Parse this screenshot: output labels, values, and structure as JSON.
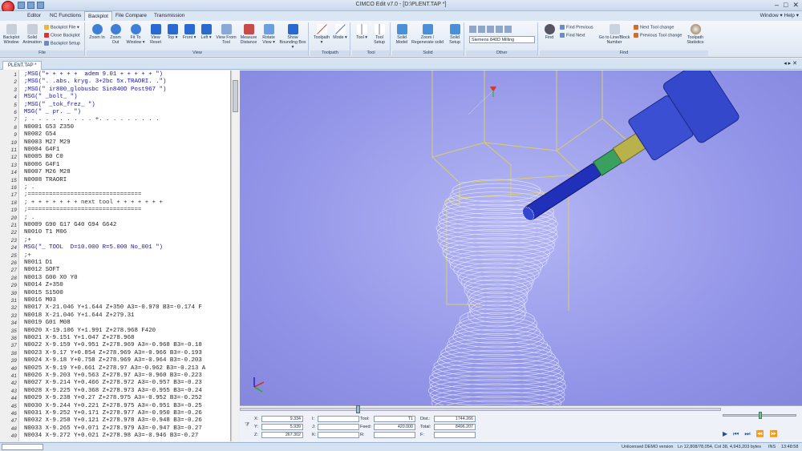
{
  "window": {
    "title": "CIMCO Edit v7.0 - [D:\\PLENT.TAP *]",
    "controls": [
      "–",
      "□",
      "✕"
    ]
  },
  "tabs": [
    "Editor",
    "NC Functions",
    "Backplot",
    "File Compare",
    "Transmission"
  ],
  "tab_right": "Window ▾  Help ▾",
  "ribbon": {
    "file": {
      "label": "File",
      "big": [
        "Backplot Window",
        "Solid Animation"
      ],
      "small": [
        "Backplot File ▾",
        "Close Backplot",
        "Backplot Setup"
      ]
    },
    "view": {
      "label": "View",
      "buttons": [
        "Zoom In",
        "Zoom Out",
        "Fit To Window ▾",
        "View Reset",
        "Top ▾",
        "Front ▾",
        "Left ▾",
        "View From Tool",
        "Measure Distance",
        "Rotate View ▾",
        "Show Bounding Box ▾"
      ]
    },
    "toolpath": {
      "label": "Toolpath",
      "buttons": [
        "Toolpath ▾",
        "Mode ▾"
      ]
    },
    "tool": {
      "label": "Tool",
      "buttons": [
        "Tool ▾",
        "Tool Setup"
      ]
    },
    "solid": {
      "label": "Solid",
      "buttons": [
        "Solid Model",
        "Zoom / Regenerate solid",
        "Solid Setup"
      ]
    },
    "other": {
      "label": "Other",
      "combo": "Siemens 840D Milling"
    },
    "find": {
      "label": "Find",
      "big": [
        "Find",
        "Go to Line/Block Number",
        "Toolpath Statistics"
      ],
      "small": [
        "Find Previous",
        "Find Next",
        "Next Tool change",
        "Previous Tool change"
      ]
    }
  },
  "doc_tab": "PLENT.TAP *",
  "code_lines": [
    {
      "n": "1",
      "t": ";MSG(\"+ + + + +  adem 9.01 + + + + + \")",
      "c": "#1515a8"
    },
    {
      "n": "2",
      "t": ";MSG(\". .abs. kryg. 3+2bc 5x.TRAORI. .\")",
      "c": "#1515a8"
    },
    {
      "n": "3",
      "t": ";MSG(\" ir800_globusbc Sin840D Post967 \")",
      "c": "#1515a8"
    },
    {
      "n": "4",
      "t": "MSG(\" _bolt_ \")",
      "c": "#1515a8"
    },
    {
      "n": "5",
      "t": ";MSG(\" _tok_frez_ \")",
      "c": "#1515a8"
    },
    {
      "n": "6",
      "t": "MSG(\" _ pr. _ \")",
      "c": "#1515a8"
    },
    {
      "n": "7",
      "t": "; . . . . . . . . . +. . . . . . . . .",
      "c": "#333333"
    },
    {
      "n": "8",
      "t": "N0001 G53 Z350",
      "c": "#222222"
    },
    {
      "n": "9",
      "t": "N0002 G54",
      "c": "#222222"
    },
    {
      "n": "10",
      "t": "N0003 M27 M29",
      "c": "#222222"
    },
    {
      "n": "11",
      "t": "N0004 G4F1",
      "c": "#222222"
    },
    {
      "n": "12",
      "t": "N0005 B0 C0",
      "c": "#222222"
    },
    {
      "n": "13",
      "t": "N0006 G4F1",
      "c": "#222222"
    },
    {
      "n": "14",
      "t": "N0007 M26 M28",
      "c": "#222222"
    },
    {
      "n": "15",
      "t": "N0008 TRAORI",
      "c": "#222222"
    },
    {
      "n": "16",
      "t": "; .",
      "c": "#333333"
    },
    {
      "n": "17",
      "t": ";================================",
      "c": "#444444"
    },
    {
      "n": "18",
      "t": "; + + + + + + + next tool + + + + + + +",
      "c": "#333333"
    },
    {
      "n": "19",
      "t": ";================================",
      "c": "#444444"
    },
    {
      "n": "20",
      "t": "; .",
      "c": "#333333"
    },
    {
      "n": "21",
      "t": "N0009 G90 G17 G40 G94 G642",
      "c": "#222222"
    },
    {
      "n": "22",
      "t": "N0010 T1 M06",
      "c": "#222222"
    },
    {
      "n": "23",
      "t": ";+",
      "c": "#333333"
    },
    {
      "n": "24",
      "t": "MSG(\"_ TOOL  D=10.000 R=5.000 No_001 \")",
      "c": "#1515a8"
    },
    {
      "n": "25",
      "t": ";+",
      "c": "#333333"
    },
    {
      "n": "26",
      "t": "N0011 D1",
      "c": "#222222"
    },
    {
      "n": "27",
      "t": "N0012 SOFT",
      "c": "#222222"
    },
    {
      "n": "28",
      "t": "N0013 G00 X0 Y0",
      "c": "#222222"
    },
    {
      "n": "29",
      "t": "N0014 Z+350",
      "c": "#222222"
    },
    {
      "n": "30",
      "t": "N0015 S1500",
      "c": "#222222"
    },
    {
      "n": "31",
      "t": "N0016 M03",
      "c": "#222222"
    },
    {
      "n": "32",
      "t": "N0017 X-21.046 Y+1.644 Z+350 A3=-0.970 B3=-0.174 F",
      "c": "#222222"
    },
    {
      "n": "33",
      "t": "N0018 X-21.046 Y+1.644 Z+279.31",
      "c": "#222222"
    },
    {
      "n": "34",
      "t": "N0019 G01 M08",
      "c": "#222222"
    },
    {
      "n": "35",
      "t": "N0020 X-19.106 Y+1.991 Z+278.968 F420",
      "c": "#222222"
    },
    {
      "n": "36",
      "t": "N0021 X-9.151 Y+1.047 Z+278.968",
      "c": "#222222"
    },
    {
      "n": "37",
      "t": "N0022 X-9.159 Y+0.951 Z+278.969 A3=-0.968 B3=-0.18",
      "c": "#222222"
    },
    {
      "n": "38",
      "t": "N0023 X-9.17 Y+0.854 Z+278.969 A3=-0.966 B3=-0.193",
      "c": "#222222"
    },
    {
      "n": "39",
      "t": "N0024 X-9.18 Y+0.758 Z+278.969 A3=-0.964 B3=-0.203",
      "c": "#222222"
    },
    {
      "n": "40",
      "t": "N0025 X-9.19 Y+0.661 Z+278.97 A3=-0.962 B3=-0.213 A",
      "c": "#222222"
    },
    {
      "n": "41",
      "t": "N0026 X-9.203 Y+0.563 Z+278.97 A3=-0.960 B3=-0.223",
      "c": "#222222"
    },
    {
      "n": "42",
      "t": "N0027 X-9.214 Y+0.466 Z+278.972 A3=-0.957 B3=-0.23",
      "c": "#222222"
    },
    {
      "n": "43",
      "t": "N0028 X-9.225 Y+0.368 Z+278.973 A3=-0.955 B3=-0.24",
      "c": "#222222"
    },
    {
      "n": "44",
      "t": "N0029 X-9.238 Y+0.27 Z+278.975 A3=-0.952 B3=-0.252",
      "c": "#222222"
    },
    {
      "n": "45",
      "t": "N0030 X-9.244 Y+0.221 Z+278.975 A3=-0.951 B3=-0.25",
      "c": "#222222"
    },
    {
      "n": "46",
      "t": "N0031 X-9.252 Y+0.171 Z+278.977 A3=-0.950 B3=-0.26",
      "c": "#222222"
    },
    {
      "n": "47",
      "t": "N0032 X-9.258 Y+0.121 Z+278.978 A3=-0.948 B3=-0.26",
      "c": "#222222"
    },
    {
      "n": "48",
      "t": "N0033 X-9.265 Y+0.071 Z+278.979 A3=-0.947 B3=-0.27",
      "c": "#222222"
    },
    {
      "n": "49",
      "t": "N0034 X-9.272 Y+0.021 Z+278.98 A3=-0.946 B3=-0.27",
      "c": "#222222"
    }
  ],
  "readout": {
    "x": {
      "label": "X:",
      "value": "9.334"
    },
    "y": {
      "label": "Y:",
      "value": "5.939"
    },
    "z": {
      "label": "Z:",
      "value": "267.302"
    },
    "i": {
      "label": "I:",
      "value": ""
    },
    "j": {
      "label": "J:",
      "value": ""
    },
    "k": {
      "label": "K:",
      "value": ""
    },
    "tool": {
      "label": "Tool:",
      "value": "T1"
    },
    "feed": {
      "label": "Feed:",
      "value": "420.000"
    },
    "r": {
      "label": "R:",
      "value": ""
    },
    "dist": {
      "label": "Dist.:",
      "value": "1744.266"
    },
    "total": {
      "label": "Total:",
      "value": "8496.207"
    },
    "f": {
      "label": "F:",
      "value": ""
    }
  },
  "status": {
    "left": "",
    "demo": "Unlicensed DEMO version",
    "pos": "Ln 12,808/78,054, Col 38, 4,943,203 bytes",
    "mode": "INS",
    "time": "13:48:58"
  },
  "colors": {
    "viewport_bg": "#9194e7",
    "tool_shaft": "#2233bb",
    "accent": "#c01010"
  }
}
